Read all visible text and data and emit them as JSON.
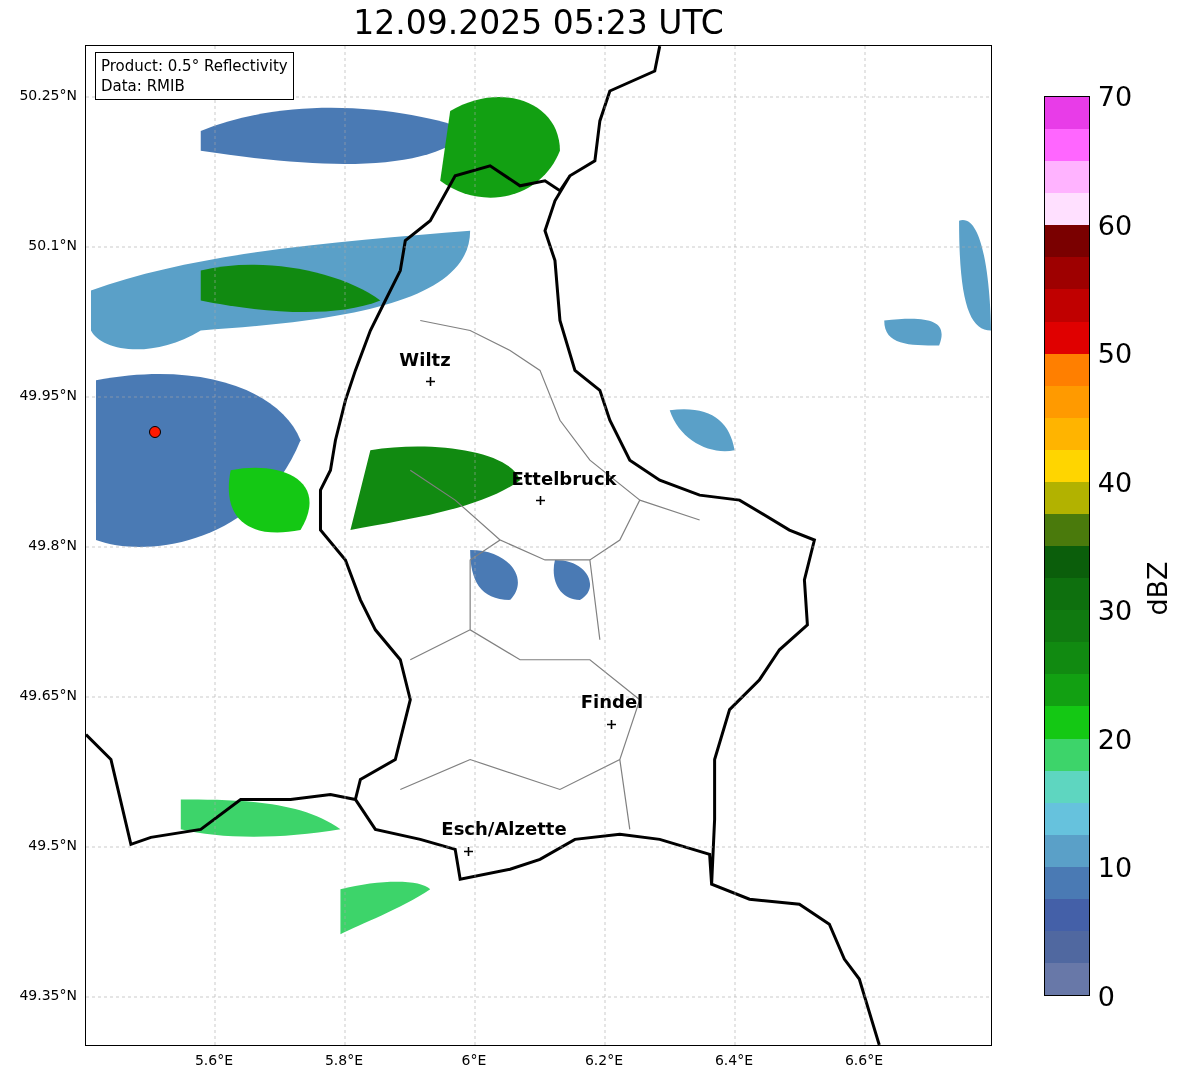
{
  "title": "12.09.2025 05:23 UTC",
  "map": {
    "legend": [
      "Product: 0.5° Reflectivity",
      "Data: RMIB"
    ],
    "yticks": [
      "50.25°N",
      "50.1°N",
      "49.95°N",
      "49.8°N",
      "49.65°N",
      "49.5°N",
      "49.35°N"
    ],
    "xticks": [
      "5.6°E",
      "5.8°E",
      "6°E",
      "6.2°E",
      "6.4°E",
      "6.6°E"
    ],
    "places": [
      {
        "name": "Wiltz"
      },
      {
        "name": "Ettelbruck"
      },
      {
        "name": "Findel"
      },
      {
        "name": "Esch/Alzette"
      }
    ]
  },
  "colorbar": {
    "label": "dBZ",
    "ticks": [
      "70",
      "60",
      "50",
      "40",
      "30",
      "20",
      "10",
      "0"
    ],
    "bins": [
      {
        "color": "#e83ce8"
      },
      {
        "color": "#ff66ff"
      },
      {
        "color": "#ffb3ff"
      },
      {
        "color": "#ffe0ff"
      },
      {
        "color": "#7a0000"
      },
      {
        "color": "#9e0000"
      },
      {
        "color": "#c00000"
      },
      {
        "color": "#e00000"
      },
      {
        "color": "#ff7f00"
      },
      {
        "color": "#ff9a00"
      },
      {
        "color": "#ffb400"
      },
      {
        "color": "#ffd500"
      },
      {
        "color": "#b2b200"
      },
      {
        "color": "#4a7a0c"
      },
      {
        "color": "#0b5e0b"
      },
      {
        "color": "#0e700e"
      },
      {
        "color": "#107a10"
      },
      {
        "color": "#118a11"
      },
      {
        "color": "#12a012"
      },
      {
        "color": "#14c814"
      },
      {
        "color": "#3dd46a"
      },
      {
        "color": "#5ed6c0"
      },
      {
        "color": "#66c2dd"
      },
      {
        "color": "#5aa0c8"
      },
      {
        "color": "#4a7ab4"
      },
      {
        "color": "#4460a8"
      },
      {
        "color": "#5068a0"
      },
      {
        "color": "#6878a8"
      }
    ]
  }
}
